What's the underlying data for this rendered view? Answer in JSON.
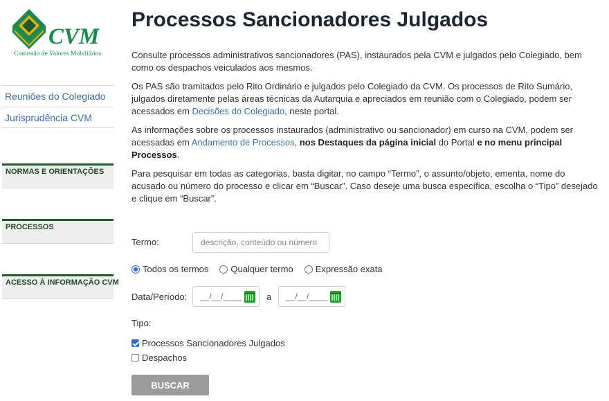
{
  "logo": {
    "name": "CVM",
    "subtitle": "Comissão de Valores Mobiliários",
    "colors": {
      "green": "#1e8a4a",
      "gold": "#e0b020",
      "dark_green": "#1f5a2a"
    }
  },
  "sidebar": {
    "links": [
      {
        "label": "Reuniões do Colegiado"
      },
      {
        "label": "Jurisprudência CVM"
      }
    ],
    "sections": [
      {
        "label": "NORMAS E ORIENTAÇÕES"
      },
      {
        "label": "PROCESSOS"
      },
      {
        "label": "ACESSO À INFORMAÇÃO CVM"
      }
    ]
  },
  "main": {
    "title": "Processos Sancionadores Julgados",
    "intro": {
      "p1": "Consulte processos administrativos sancionadores (PAS), instaurados pela CVM e julgados pelo Colegiado, bem como os despachos veiculados aos mesmos.",
      "p2_before": "Os PAS são tramitados pelo Rito Ordinário e julgados pelo Colegiado da CVM. Os processos de Rito Sumário, julgados diretamente pelas áreas técnicas da Autarquia e apreciados em reunião com o Colegiado, podem ser acessados em ",
      "p2_link": "Decisões do Colegiado",
      "p2_after": ", neste portal.",
      "p3_before": "As informações sobre os processos instaurados (administrativo ou sancionador) em curso na CVM, podem ser acessadas em ",
      "p3_link": "Andamento de Processos",
      "p3_mid": ", ",
      "p3_bold1": "nos Destaques da página inicial",
      "p3_mid2": " do Portal ",
      "p3_bold2": "e no menu principal Processos",
      "p3_end": ".",
      "p4": "Para pesquisar em todas as categorias, basta digitar, no campo “Termo”, o assunto/objeto, ementa, nome do acusado ou número do processo e clicar em “Buscar”. Caso deseje uma busca específica, escolha o “Tipo” desejado e clique em “Buscar”."
    }
  },
  "form": {
    "termo_label": "Termo:",
    "termo_value": "",
    "termo_placeholder": "descrição, conteúdo ou número",
    "radios": [
      {
        "label": "Todos os termos",
        "checked": true
      },
      {
        "label": "Qualquer termo",
        "checked": false
      },
      {
        "label": "Expressão exata",
        "checked": false
      }
    ],
    "date_label": "Data/Período:",
    "date_from": "__/__/____",
    "date_separator": "a",
    "date_to": "__/__/____",
    "calendar_icon": "calendar-icon",
    "tipo_label": "Tipo:",
    "tipos": [
      {
        "label": "Processos Sancionadores Julgados",
        "checked": true
      },
      {
        "label": "Despachos",
        "checked": false
      }
    ],
    "submit_label": "BUSCAR"
  }
}
